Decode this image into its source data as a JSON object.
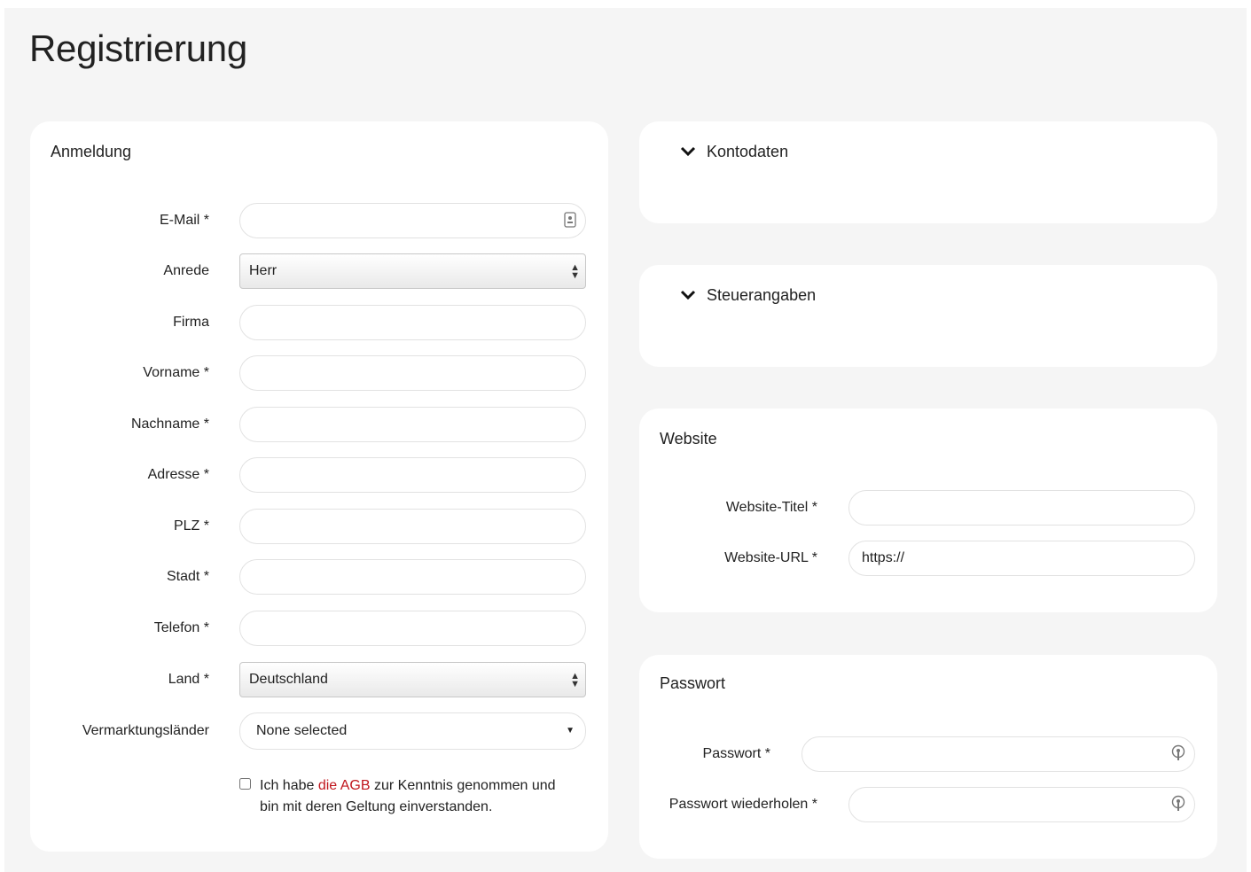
{
  "page": {
    "title": "Registrierung"
  },
  "anmeldung": {
    "title": "Anmeldung",
    "email_label": "E-Mail *",
    "anrede_label": "Anrede",
    "anrede_value": "Herr",
    "firma_label": "Firma",
    "vorname_label": "Vorname *",
    "nachname_label": "Nachname *",
    "adresse_label": "Adresse *",
    "plz_label": "PLZ *",
    "stadt_label": "Stadt *",
    "telefon_label": "Telefon *",
    "land_label": "Land *",
    "land_value": "Deutschland",
    "vermarktung_label": "Vermarktungsländer",
    "vermarktung_value": "None selected",
    "terms_prefix": "Ich habe ",
    "terms_link": "die AGB",
    "terms_suffix": " zur Kenntnis genommen und bin mit deren Geltung einverstanden."
  },
  "kontodaten": {
    "title": "Kontodaten"
  },
  "steuerangaben": {
    "title": "Steuerangaben"
  },
  "website": {
    "title": "Website",
    "titel_label": "Website-Titel *",
    "url_label": "Website-URL *",
    "url_value": "https://"
  },
  "passwort": {
    "title": "Passwort",
    "passwort_label": "Passwort *",
    "wiederholen_label": "Passwort wiederholen *"
  },
  "colors": {
    "background": "#f5f5f5",
    "card": "#ffffff",
    "link": "#c0161d"
  },
  "icons": {
    "email_field": "contact-card-icon",
    "password_field": "key-icon",
    "collapse": "chevron-down-icon"
  }
}
